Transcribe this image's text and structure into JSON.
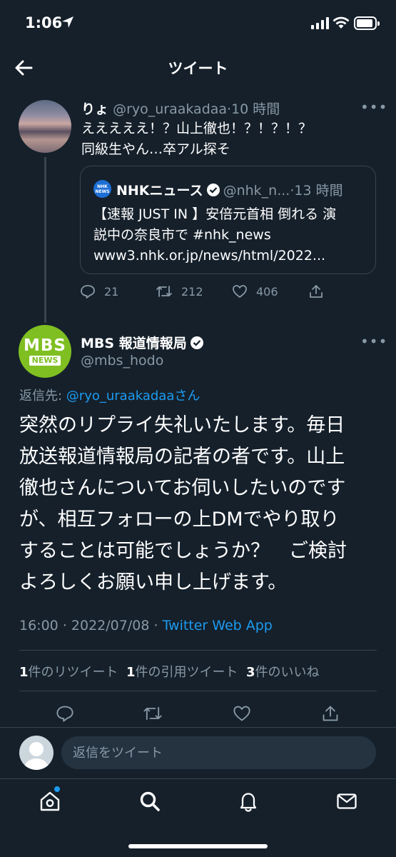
{
  "status_bar": {
    "time": "1:06"
  },
  "nav": {
    "title": "ツイート"
  },
  "parent_tweet": {
    "name": "りょ",
    "handle": "@ryo_uraakadaa",
    "separator": "·",
    "time": "10 時間",
    "text_lines": [
      "えええええ！？山上徹也！？！？！？",
      "同級生やん…卒アル探そ"
    ],
    "quoted": {
      "logo_top": "NHK",
      "logo_bottom": "NEWS",
      "name": "NHKニュース",
      "handle": "@nhk_n...",
      "separator": "·",
      "time": "13 時間",
      "text_lines": [
        "【速報 JUST IN 】安倍元首相 倒れる 演",
        "説中の奈良市で #nhk_news",
        "www3.nhk.or.jp/news/html/2022..."
      ]
    },
    "counts": {
      "replies": "21",
      "retweets": "212",
      "likes": "406"
    }
  },
  "main_tweet": {
    "avatar_word": "MBS",
    "avatar_badge": "NEWS",
    "name": "MBS 報道情報局",
    "handle": "@mbs_hodo",
    "reply_prefix": "返信先: ",
    "reply_target": "@ryo_uraakadaa",
    "reply_suffix": "さん",
    "text_lines": [
      "突然のリプライ失礼いたします。毎日",
      "放送報道情報局の記者の者です。山上",
      "徹也さんについてお伺いしたいのです",
      "が、相互フォローの上DMでやり取り",
      "することは可能でしょうか？　ご検討",
      "よろしくお願い申し上げます。"
    ],
    "time": "16:00",
    "date": "2022/07/08",
    "separator": "·",
    "source": "Twitter Web App",
    "stats": {
      "retweets_count": "1",
      "retweets_label": "件のリツイート",
      "quotes_count": "1",
      "quotes_label": "件の引用ツイート",
      "likes_count": "3",
      "likes_label": "件のいいね"
    }
  },
  "reply_box": {
    "placeholder": "返信をツイート"
  },
  "icons": {
    "back": "arrow-left-icon",
    "more": "more-icon",
    "reply": "reply-icon",
    "retweet": "retweet-icon",
    "like": "heart-icon",
    "share": "share-icon",
    "home": "home-icon",
    "search": "search-icon",
    "notifications": "bell-icon",
    "messages": "mail-icon"
  },
  "colors": {
    "background": "#15202b",
    "accent": "#1d9bf0",
    "secondary_text": "#8899a6",
    "border": "#38444d",
    "mbs_green": "#7fbf22"
  }
}
